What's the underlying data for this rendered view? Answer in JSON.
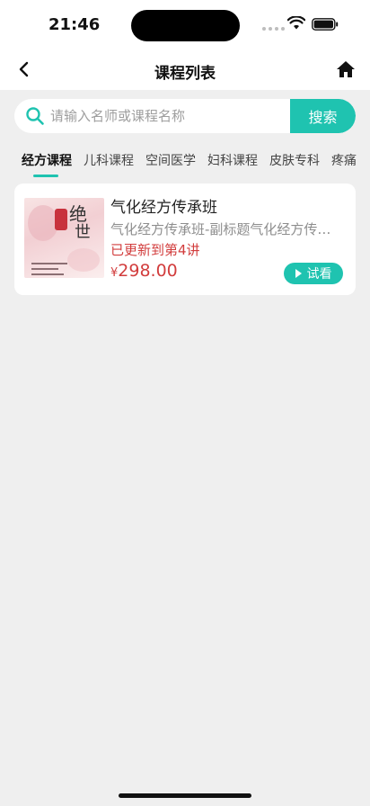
{
  "status_bar": {
    "time": "21:46"
  },
  "navbar": {
    "title": "课程列表"
  },
  "search": {
    "placeholder": "请输入名师或课程名称",
    "button_label": "搜索"
  },
  "tabs": [
    {
      "label": "经方课程",
      "active": true
    },
    {
      "label": "儿科课程",
      "active": false
    },
    {
      "label": "空间医学",
      "active": false
    },
    {
      "label": "妇科课程",
      "active": false
    },
    {
      "label": "皮肤专科",
      "active": false
    },
    {
      "label": "疼痛",
      "active": false
    }
  ],
  "courses": [
    {
      "title": "气化经方传承班",
      "subtitle": "气化经方传承班-副标题气化经方传承班",
      "update_status": "已更新到第4讲",
      "price_currency": "¥",
      "price": "298.00",
      "trial_label": "试看"
    }
  ],
  "colors": {
    "accent": "#1fc3b0",
    "price_red": "#d23d3d",
    "background": "#efefef"
  }
}
